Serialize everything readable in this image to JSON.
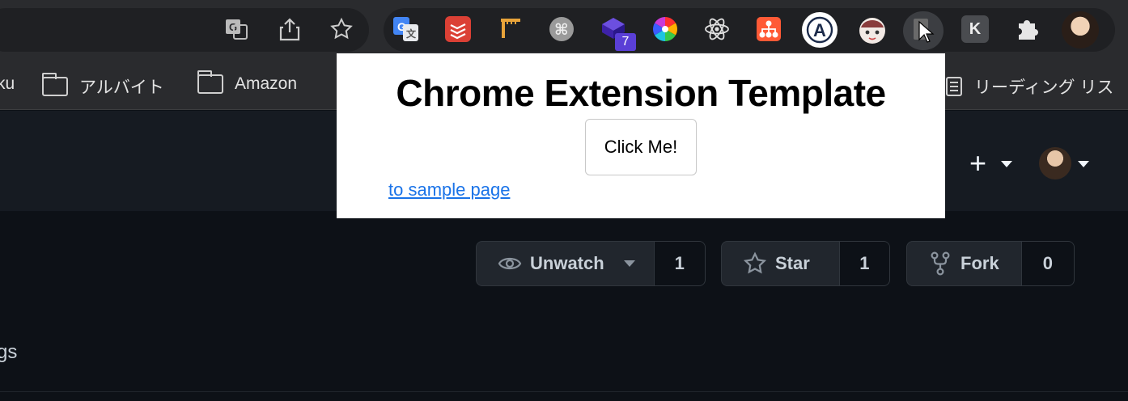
{
  "bookmarks": {
    "items": [
      {
        "label": "ku"
      },
      {
        "label": "アルバイト"
      },
      {
        "label": "Amazon"
      },
      {
        "label": "リーディング リス"
      }
    ]
  },
  "extensions": {
    "badge_count": "7",
    "k_label": "K"
  },
  "repo_actions": {
    "unwatch": {
      "label": "Unwatch",
      "count": "1"
    },
    "star": {
      "label": "Star",
      "count": "1"
    },
    "fork": {
      "label": "Fork",
      "count": "0"
    }
  },
  "page": {
    "fragment_text": "gs"
  },
  "popup": {
    "title": "Chrome Extension Template",
    "button_label": "Click Me!",
    "link_text": "to sample page"
  },
  "colors": {
    "link": "#1a73e8",
    "github_bg": "#0d1117",
    "header_bg": "#161b22"
  }
}
